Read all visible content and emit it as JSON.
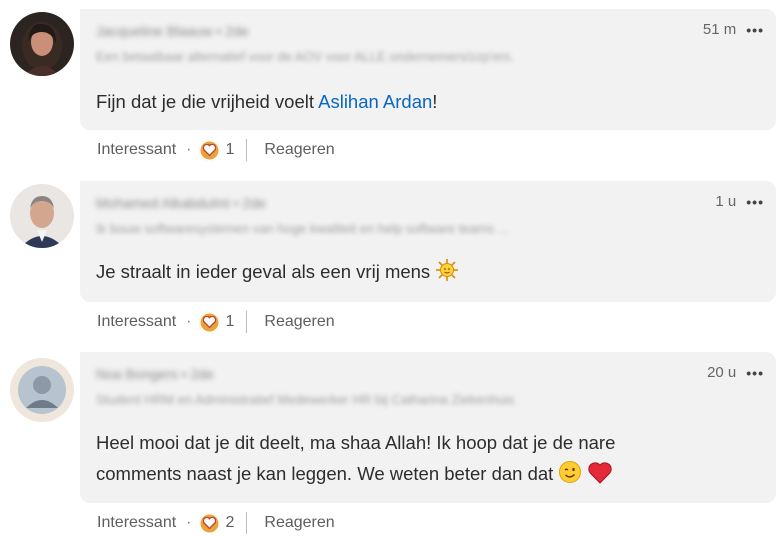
{
  "comments": [
    {
      "author_name": "Jacqueline Blaauw",
      "degree": "• 2de",
      "headline": "Een betaalbaar alternatief voor de AOV voor ALLE ondernemers/zzp'ers.",
      "time": "51 m",
      "text_before": "Fijn dat je die vrijheid voelt ",
      "mention": "Aslihan Ardan",
      "text_after": "!",
      "like_label": "Interessant",
      "reaction_count": "1",
      "reply_label": "Reageren"
    },
    {
      "author_name": "Mohamed Alkabdulmi",
      "degree": "• 2de",
      "headline": "Ik bouw softwaresystemen van hoge kwaliteit en help software teams ...",
      "time": "1 u",
      "text": "Je straalt in ieder geval als een vrij mens",
      "like_label": "Interessant",
      "reaction_count": "1",
      "reply_label": "Reageren"
    },
    {
      "author_name": "Noa Bongers",
      "degree": "• 2de",
      "headline": "Student HRM en Administratief Medewerker HR bij Catharina Ziekenhuis",
      "time": "20 u",
      "text_line1": "Heel mooi dat je dit deelt, ma shaa Allah! Ik hoop dat je de nare",
      "text_line2": "comments naast je kan leggen. We weten beter dan dat",
      "like_label": "Interessant",
      "reaction_count": "2",
      "reply_label": "Reageren"
    }
  ],
  "icons": {
    "more": "more-options-icon",
    "reaction": "heart-reaction-icon",
    "sun_emoji": "sun-emoji-icon",
    "wink_emoji": "wink-emoji-icon",
    "red_heart_emoji": "red-heart-emoji-icon"
  },
  "colors": {
    "bubble": "#f2f2f2",
    "mention": "#0a66c2",
    "reaction_badge": "#e7a33e"
  }
}
